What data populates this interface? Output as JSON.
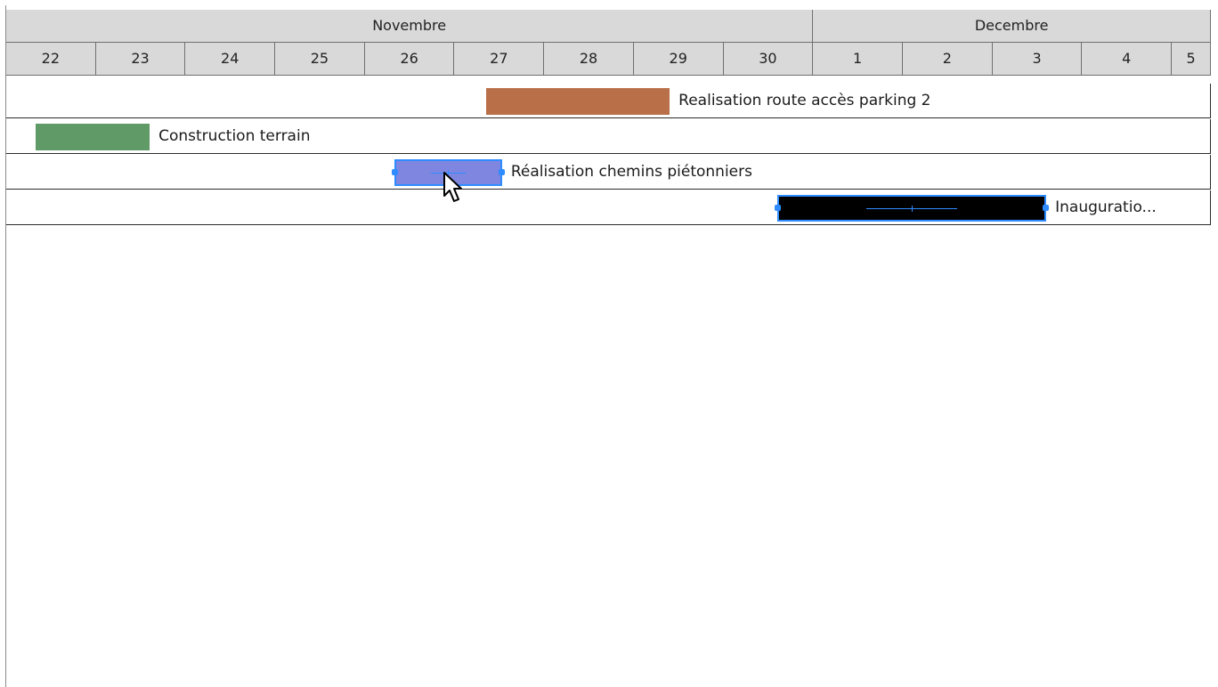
{
  "timeline": {
    "months": [
      {
        "label": "Novembre",
        "first_day": "22",
        "last_day": "30"
      },
      {
        "label": "Decembre",
        "first_day": "1",
        "last_day": "5"
      }
    ],
    "days": [
      "22",
      "23",
      "24",
      "25",
      "26",
      "27",
      "28",
      "29",
      "30",
      "1",
      "2",
      "3",
      "4",
      "5"
    ]
  },
  "tasks": [
    {
      "label": "Realisation route accès parking 2",
      "start_day": 27.35,
      "end_day": 29.4,
      "color": "#b97049",
      "selected": false
    },
    {
      "label": "Construction terrain",
      "start_day": 22.33,
      "end_day": 23.6,
      "color": "#5f9a67",
      "selected": false
    },
    {
      "label": "Réalisation chemins piétonniers",
      "start_day": 26.33,
      "end_day": 27.53,
      "color": "#7f86e0",
      "selected": true,
      "progress": 0.5
    },
    {
      "label": "Inauguratio...",
      "start_day": 30.6,
      "end_day": 33.6,
      "color": "#000000",
      "selected": true,
      "progress": 0.5
    }
  ],
  "colors": {
    "header_bg": "#d9d9d9",
    "selection": "#2f8cff",
    "grid_line": "#707070"
  },
  "icons": {
    "cursor": "mouse-pointer-icon"
  }
}
